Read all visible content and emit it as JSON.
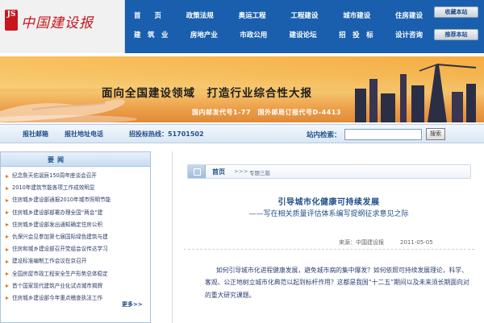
{
  "header": {
    "logo_mark": "JS",
    "logo_text": "中国建设报",
    "nav_row_1": [
      "首　　页",
      "政策法规",
      "奥运工程",
      "工程建设",
      "城市建设",
      "住房建设"
    ],
    "nav_row_2": [
      "建　筑　业",
      "房地产业",
      "市政公用",
      "建设论坛",
      "招　投　标",
      "设计咨询"
    ],
    "util_buttons": [
      "收藏本站",
      "推荐本站"
    ],
    "colors": {
      "nav_bg": "#1a5fae",
      "logo_red": "#c8161e"
    }
  },
  "banner": {
    "headline": "面向全国建设领域　打造行业综合性大报",
    "subline": "国内邮发代号1-77　国外邮局订报代号D-4413"
  },
  "infobar": {
    "items": [
      "报社邮箱",
      "报社地址电话",
      "招投标热线：51701502"
    ],
    "search_label": "站内检索：",
    "search_value": "",
    "search_button": "搜索"
  },
  "sidebar": {
    "title": "要闻",
    "items": [
      "纪念詹天佑诞辰150周年座谈会召开",
      "2010年建筑节能各项工作成效明显",
      "住房城乡建设部通报2010年城市照明节能",
      "住房城乡建设部部署办理全国“两会”建",
      "住房城乡建设部发出通知确定住房公积",
      "仇保兴会见参加第七届国际绿色建筑与建",
      "住房和城乡建设部召开党组会议传达学习",
      "建设标准编制工作会议在京召开",
      "全国房屋市政工程安全生产形势总体稳定",
      "首个国家现代建筑产业化试点城市揭牌",
      "住房城乡建设部今年重点稽查执法工作"
    ],
    "more_label": "更多>>"
  },
  "breadcrumb": {
    "home": "首页",
    "separator": ">>>",
    "section": "专题三版"
  },
  "article": {
    "title": "引导城市化健康可持续发展",
    "subtitle": "——写在相关质量评估体系编写提纲征求意见之际",
    "source": "来源：中国建设报",
    "date": "2011-05-05",
    "body": "如何引导城市化进程健康发展，避免城市病的集中爆发？如何依照可持续发展理论，科学、客观、公正地树立城市化典范以起到标杆作用？这都是我国“十二五”期间以及未来须长期面向对的重大研究课题。"
  }
}
